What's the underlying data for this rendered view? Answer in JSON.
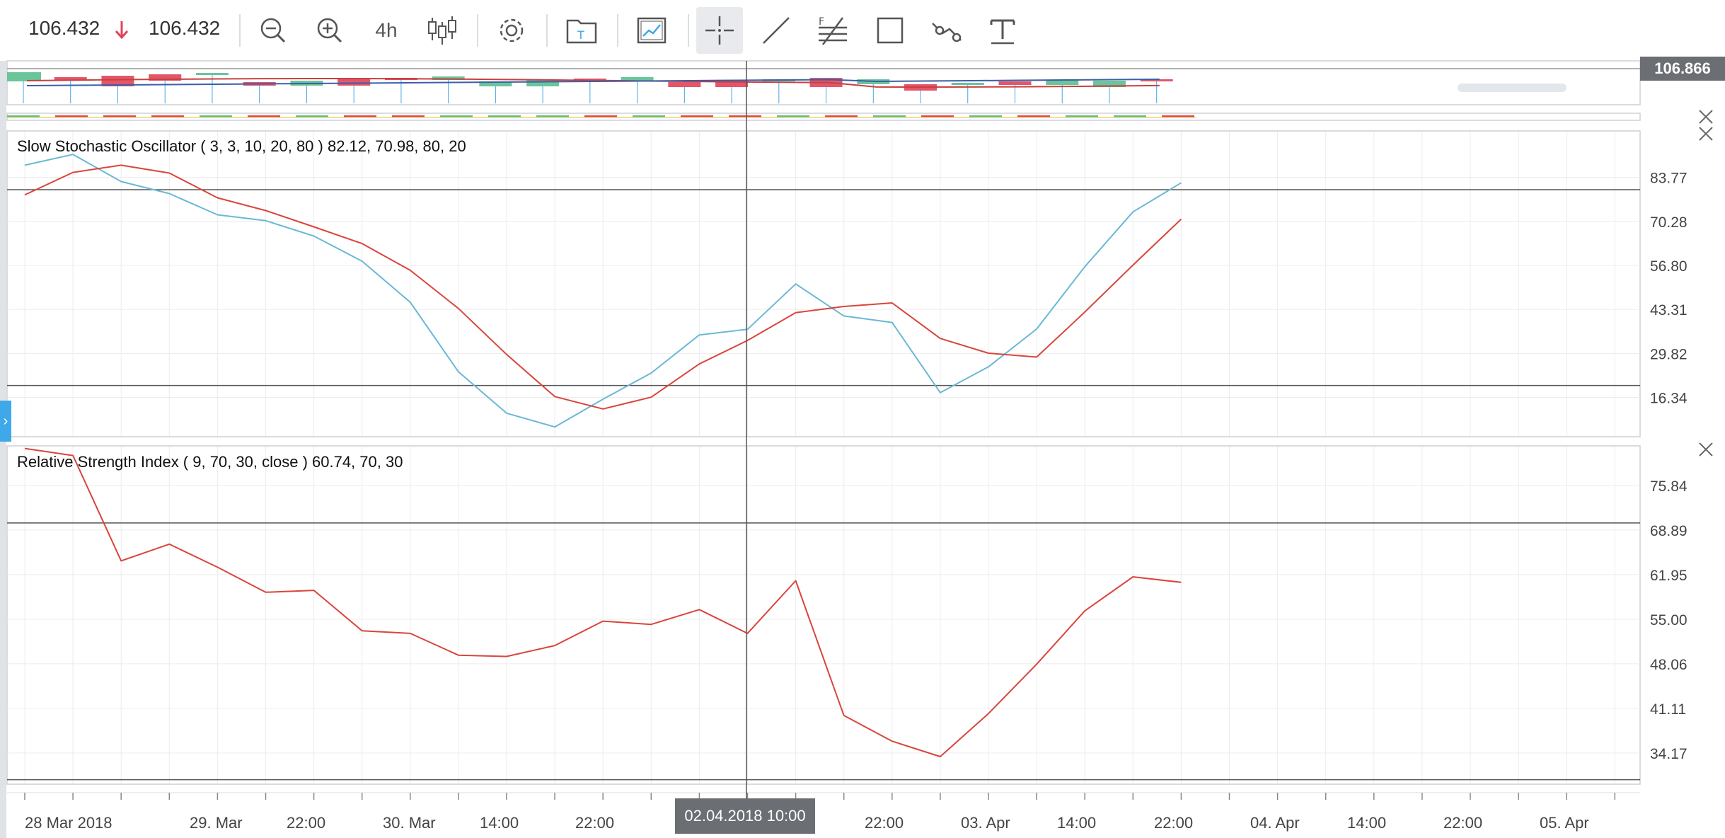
{
  "toolbar": {
    "bid": "106.432",
    "ask": "106.432",
    "direction_icon": "arrow-down-icon",
    "timeframe": "4h",
    "tools": [
      "zoom-out-icon",
      "zoom-in-icon",
      "timeframe",
      "candles-icon",
      "settings-icon",
      "template-icon",
      "indicators-icon",
      "crosshair-icon",
      "trendline-icon",
      "fibonacci-icon",
      "rectangle-icon",
      "polyline-icon",
      "text-icon"
    ]
  },
  "price_badge": "106.866",
  "crosshair_label": "02.04.2018 10:00",
  "colors": {
    "stoch_k": "#6ab8d6",
    "stoch_d": "#d9453b",
    "rsi": "#d9453b",
    "bull": "#5bbf8f",
    "bear": "#e0445a",
    "badge": "#6b6e72",
    "accent": "#3fa8e8"
  },
  "x_axis_labels": [
    "28 Mar 2018",
    "29. Mar",
    "22:00",
    "30. Mar",
    "14:00",
    "22:00",
    "02.04.2018 10:00",
    "22:00",
    "03. Apr",
    "14:00",
    "22:00",
    "04. Apr",
    "14:00",
    "22:00",
    "05. Apr"
  ],
  "chart_data": [
    {
      "type": "line",
      "title": "Slow Stochastic Oscillator ( 3, 3, 10, 20, 80 ) 82.12, 70.98, 80, 20",
      "y_ticks": [
        "83.77",
        "70.28",
        "56.80",
        "43.31",
        "29.82",
        "16.34"
      ],
      "ylim": [
        4.3,
        98
      ],
      "levels": [
        80,
        20
      ],
      "series": [
        {
          "values": [
            87.5,
            90.8,
            82.5,
            78.8,
            72.3,
            70.5,
            65.8,
            58.1,
            45.5,
            24.2,
            11.5,
            7.3,
            15.8,
            23.8,
            35.5,
            37.2,
            51.1,
            41.3,
            39.3,
            17.8,
            25.7,
            37.3,
            56.4,
            73.2,
            82.1
          ]
        },
        {
          "values": [
            78.4,
            85.3,
            87.5,
            85.1,
            77.5,
            73.6,
            68.6,
            63.5,
            55.3,
            43.6,
            29.5,
            16.6,
            12.8,
            16.4,
            26.6,
            33.8,
            42.3,
            44.2,
            45.3,
            34.4,
            29.9,
            28.7,
            42.5,
            56.9,
            70.98
          ]
        }
      ]
    },
    {
      "type": "line",
      "title": "Relative Strength Index ( 9, 70, 30, close ) 60.74, 70, 30",
      "y_ticks": [
        "75.84",
        "68.89",
        "61.95",
        "55.00",
        "48.06",
        "41.11",
        "34.17"
      ],
      "ylim": [
        29.3,
        82
      ],
      "levels": [
        70,
        30
      ],
      "series": [
        {
          "values": [
            81.6,
            80.5,
            64.1,
            66.7,
            63.1,
            59.2,
            59.5,
            53.2,
            52.8,
            49.4,
            49.2,
            50.9,
            54.7,
            54.2,
            56.5,
            52.8,
            61.0,
            40.0,
            36.0,
            33.6,
            40.3,
            48.0,
            56.3,
            61.6,
            60.74
          ]
        }
      ]
    }
  ]
}
